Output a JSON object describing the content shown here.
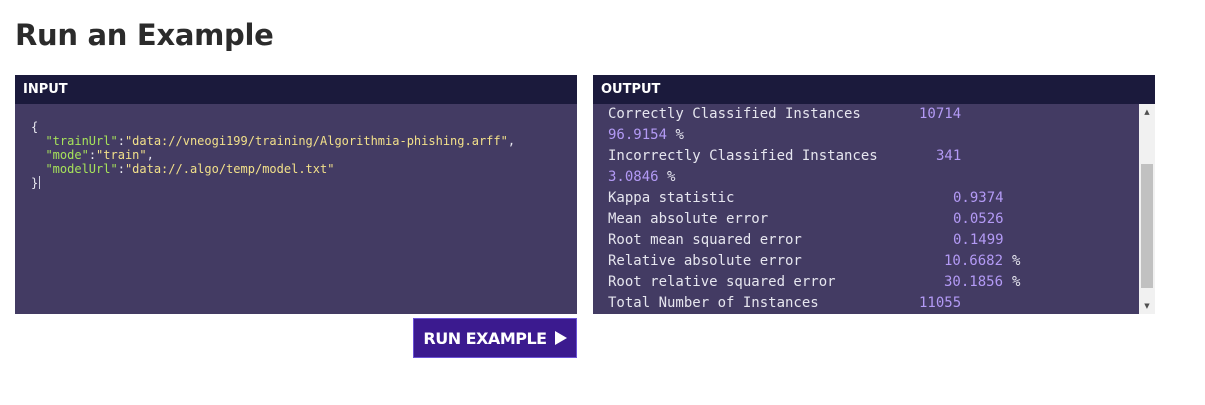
{
  "page": {
    "title": "Run an Example"
  },
  "input": {
    "header": "INPUT",
    "open_brace": "{",
    "close_brace": "}",
    "lines": [
      {
        "key": "\"trainUrl\"",
        "value": "\"data://vneogi199/training/Algorithmia-phishing.arff\"",
        "trail": ","
      },
      {
        "key": "\"mode\"",
        "value": "\"train\"",
        "trail": ","
      },
      {
        "key": "\"modelUrl\"",
        "value": "\"data://.algo/temp/model.txt\"",
        "trail": ""
      }
    ]
  },
  "output": {
    "header": "OUTPUT",
    "rows": [
      {
        "label": "Correctly Classified Instances",
        "value": "10714",
        "suffix": ""
      },
      {
        "label": "",
        "value": "96.9154",
        "suffix": "%"
      },
      {
        "label": "Incorrectly Classified Instances",
        "value": "341",
        "suffix": ""
      },
      {
        "label": "",
        "value": "3.0846",
        "suffix": "%"
      },
      {
        "label": "Kappa statistic",
        "value": "0.9374",
        "suffix": ""
      },
      {
        "label": "Mean absolute error",
        "value": "0.0526",
        "suffix": ""
      },
      {
        "label": "Root mean squared error",
        "value": "0.1499",
        "suffix": ""
      },
      {
        "label": "Relative absolute error",
        "value": "10.6682",
        "suffix": "%"
      },
      {
        "label": "Root relative squared error",
        "value": "30.1856",
        "suffix": "%"
      },
      {
        "label": "Total Number of Instances",
        "value": "11055",
        "suffix": ""
      }
    ]
  },
  "run_button": {
    "label": "RUN EXAMPLE",
    "icon": "play-icon"
  },
  "colors": {
    "panel": "#433b63",
    "header": "#1b1a3c",
    "button": "#3b1a8f",
    "number": "#b39af5"
  }
}
